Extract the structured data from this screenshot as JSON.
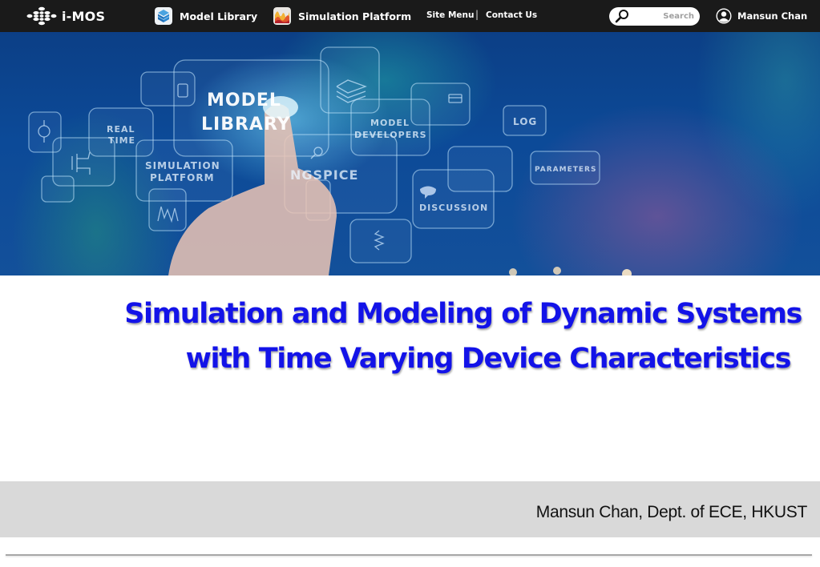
{
  "nav": {
    "logo_text": "i-MOS",
    "links": [
      {
        "label": "Model Library",
        "icon": "model-library-cube-icon"
      },
      {
        "label": "Simulation Platform",
        "icon": "simulation-platform-chart-icon"
      }
    ],
    "site_menu": "Site Menu",
    "separator": "|",
    "contact_us": "Contact Us",
    "search": {
      "placeholder": "Search",
      "value": "",
      "icon": "search-icon"
    },
    "user": {
      "name": "Mansun Chan",
      "icon": "user-avatar-icon"
    }
  },
  "hero": {
    "labels": {
      "model_library_1": "MODEL",
      "model_library_2": "LIBRARY",
      "real_time_1": "REAL",
      "real_time_2": "TIME",
      "simulation_platform_1": "SIMULATION",
      "simulation_platform_2": "PLATFORM",
      "model_developers_1": "MODEL",
      "model_developers_2": "DEVELOPERS",
      "ngspice": "NGSPICE",
      "log": "LOG",
      "parameters": "PARAMETERS",
      "discussion": "DISCUSSION"
    }
  },
  "slide": {
    "title_line1": "Simulation and Modeling of Dynamic Systems",
    "title_line2": "with Time Varying Device Characteristics",
    "title_color": "#1313e8",
    "author": "Mansun Chan, Dept. of ECE, HKUST"
  }
}
